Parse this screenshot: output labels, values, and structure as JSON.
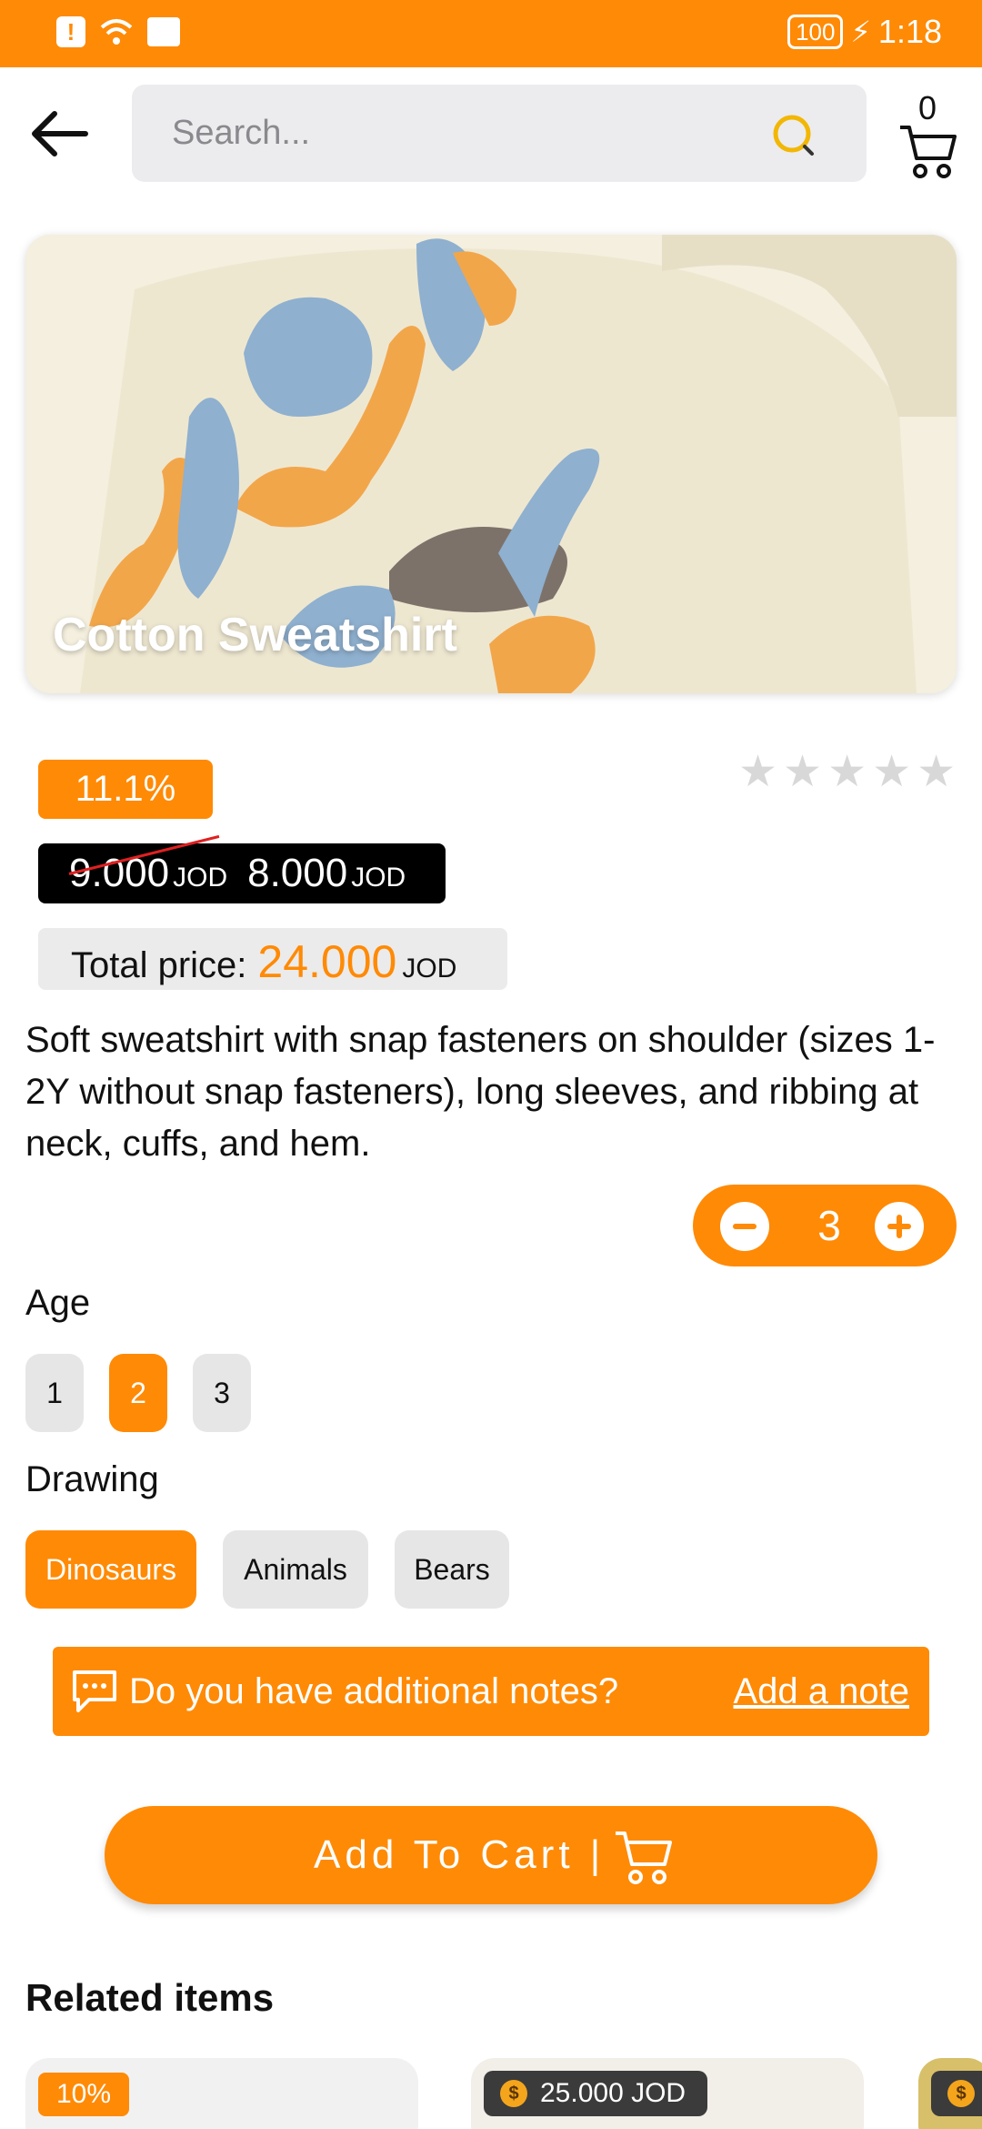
{
  "status_bar": {
    "battery": "100",
    "time": "1:18"
  },
  "header": {
    "search_placeholder": "Search...",
    "cart_count": "0"
  },
  "product": {
    "title": "Cotton Sweatshirt",
    "discount": "11.1%",
    "rating": 0,
    "old_price": "9.000",
    "new_price": "8.000",
    "currency": "JOD",
    "total_label": "Total price:",
    "total_value": "24.000",
    "description": "Soft sweatshirt with snap fasteners on shoulder (sizes 1-2Y without snap fasteners), long sleeves, and ribbing at neck, cuffs, and hem.",
    "quantity": "3"
  },
  "options": {
    "age_label": "Age",
    "ages": [
      "1",
      "2",
      "3"
    ],
    "age_selected": "2",
    "drawing_label": "Drawing",
    "drawings": [
      "Dinosaurs",
      "Animals",
      "Bears"
    ],
    "drawing_selected": "Dinosaurs"
  },
  "note": {
    "question": "Do you have additional notes?",
    "link": "Add a note"
  },
  "add_to_cart": {
    "label": "Add To Cart |"
  },
  "related": {
    "title": "Related items",
    "items": [
      {
        "badge": "10%"
      },
      {
        "price": "25.000 JOD"
      },
      {
        "price": ""
      }
    ]
  },
  "colors": {
    "accent": "#ff8a05",
    "chip_bg": "#e6e6e6",
    "price_box": "#000000"
  }
}
